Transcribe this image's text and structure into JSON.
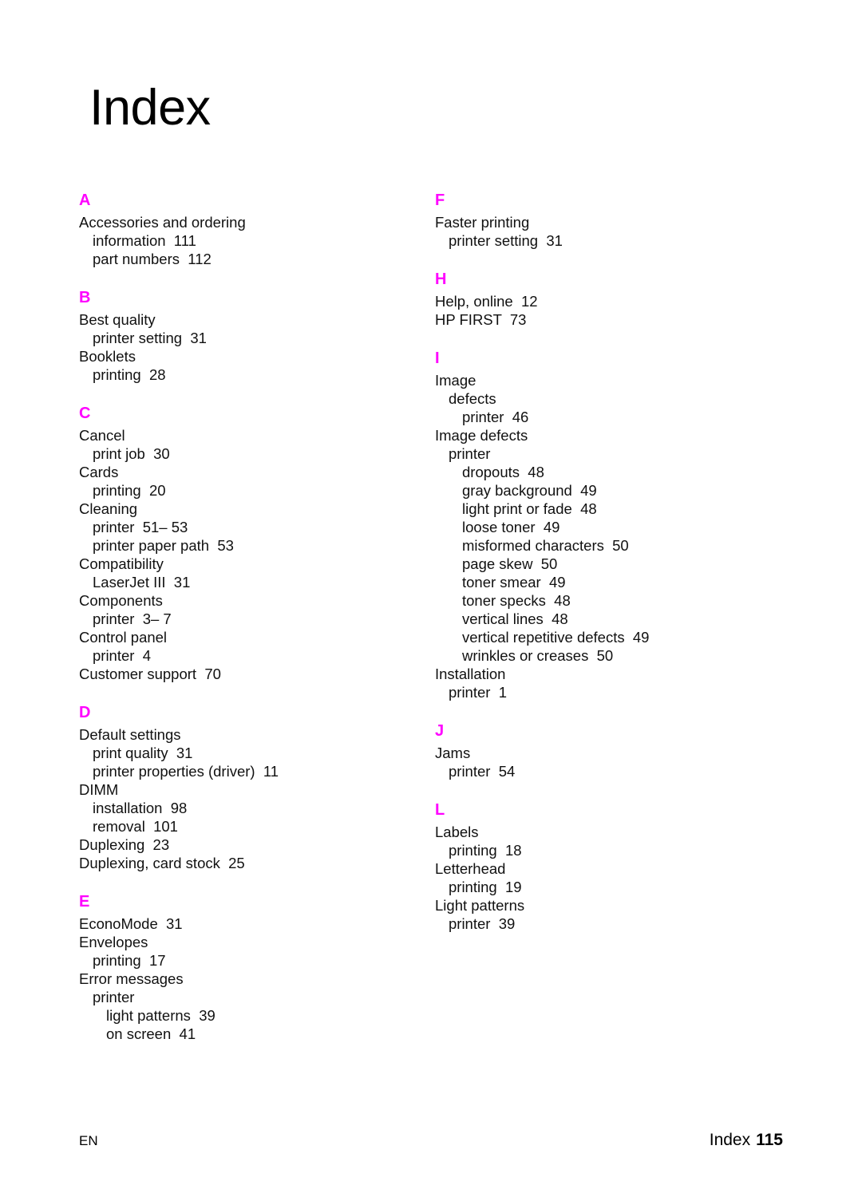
{
  "page": {
    "title": "Index"
  },
  "footer": {
    "left_label": "EN",
    "right_label": "Index",
    "page_number": "115"
  },
  "colors": {
    "section_letter": "#ff00ff",
    "text": "#111111",
    "background": "#ffffff"
  },
  "columns": [
    {
      "name": "left",
      "sections": [
        {
          "letter": "A",
          "entries": [
            {
              "level": 1,
              "text": "Accessories and ordering"
            },
            {
              "level": 2,
              "text": "information  111"
            },
            {
              "level": 2,
              "text": "part numbers  112"
            }
          ]
        },
        {
          "letter": "B",
          "entries": [
            {
              "level": 1,
              "text": "Best quality"
            },
            {
              "level": 2,
              "text": "printer setting  31"
            },
            {
              "level": 1,
              "text": "Booklets"
            },
            {
              "level": 2,
              "text": "printing  28"
            }
          ]
        },
        {
          "letter": "C",
          "entries": [
            {
              "level": 1,
              "text": "Cancel"
            },
            {
              "level": 2,
              "text": "print job  30"
            },
            {
              "level": 1,
              "text": "Cards"
            },
            {
              "level": 2,
              "text": "printing  20"
            },
            {
              "level": 1,
              "text": "Cleaning"
            },
            {
              "level": 2,
              "text": "printer  51– 53"
            },
            {
              "level": 2,
              "text": "printer paper path  53"
            },
            {
              "level": 1,
              "text": "Compatibility"
            },
            {
              "level": 2,
              "text": "LaserJet III  31"
            },
            {
              "level": 1,
              "text": "Components"
            },
            {
              "level": 2,
              "text": "printer  3– 7"
            },
            {
              "level": 1,
              "text": "Control panel"
            },
            {
              "level": 2,
              "text": "printer  4"
            },
            {
              "level": 1,
              "text": "Customer support  70"
            }
          ]
        },
        {
          "letter": "D",
          "entries": [
            {
              "level": 1,
              "text": "Default settings"
            },
            {
              "level": 2,
              "text": "print quality  31"
            },
            {
              "level": 2,
              "text": "printer properties (driver)  11"
            },
            {
              "level": 1,
              "text": "DIMM"
            },
            {
              "level": 2,
              "text": "installation  98"
            },
            {
              "level": 2,
              "text": "removal  101"
            },
            {
              "level": 1,
              "text": "Duplexing  23"
            },
            {
              "level": 1,
              "text": "Duplexing, card stock  25"
            }
          ]
        },
        {
          "letter": "E",
          "entries": [
            {
              "level": 1,
              "text": "EconoMode  31"
            },
            {
              "level": 1,
              "text": "Envelopes"
            },
            {
              "level": 2,
              "text": "printing  17"
            },
            {
              "level": 1,
              "text": "Error messages"
            },
            {
              "level": 2,
              "text": "printer"
            },
            {
              "level": 3,
              "text": "light patterns  39"
            },
            {
              "level": 3,
              "text": "on screen  41"
            }
          ]
        }
      ]
    },
    {
      "name": "right",
      "sections": [
        {
          "letter": "F",
          "entries": [
            {
              "level": 1,
              "text": "Faster printing"
            },
            {
              "level": 2,
              "text": "printer setting  31"
            }
          ]
        },
        {
          "letter": "H",
          "entries": [
            {
              "level": 1,
              "text": "Help, online  12"
            },
            {
              "level": 1,
              "text": "HP FIRST  73"
            }
          ]
        },
        {
          "letter": "I",
          "entries": [
            {
              "level": 1,
              "text": "Image"
            },
            {
              "level": 2,
              "text": "defects"
            },
            {
              "level": 3,
              "text": "printer  46"
            },
            {
              "level": 1,
              "text": "Image defects"
            },
            {
              "level": 2,
              "text": "printer"
            },
            {
              "level": 3,
              "text": "dropouts  48"
            },
            {
              "level": 3,
              "text": "gray background  49"
            },
            {
              "level": 3,
              "text": "light print or fade  48"
            },
            {
              "level": 3,
              "text": "loose toner  49"
            },
            {
              "level": 3,
              "text": "misformed characters  50"
            },
            {
              "level": 3,
              "text": "page skew  50"
            },
            {
              "level": 3,
              "text": "toner smear  49"
            },
            {
              "level": 3,
              "text": "toner specks  48"
            },
            {
              "level": 3,
              "text": "vertical lines  48"
            },
            {
              "level": 3,
              "text": "vertical repetitive defects  49"
            },
            {
              "level": 3,
              "text": "wrinkles or creases  50"
            },
            {
              "level": 1,
              "text": "Installation"
            },
            {
              "level": 2,
              "text": "printer  1"
            }
          ]
        },
        {
          "letter": "J",
          "entries": [
            {
              "level": 1,
              "text": "Jams"
            },
            {
              "level": 2,
              "text": "printer  54"
            }
          ]
        },
        {
          "letter": "L",
          "entries": [
            {
              "level": 1,
              "text": "Labels"
            },
            {
              "level": 2,
              "text": "printing  18"
            },
            {
              "level": 1,
              "text": "Letterhead"
            },
            {
              "level": 2,
              "text": "printing  19"
            },
            {
              "level": 1,
              "text": "Light patterns"
            },
            {
              "level": 2,
              "text": "printer  39"
            }
          ]
        }
      ]
    }
  ]
}
